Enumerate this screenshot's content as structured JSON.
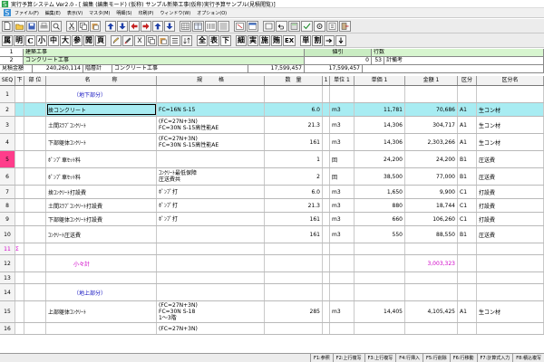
{
  "window": {
    "title": "実行予算システム Ver2.0 - [ 編集 (編集モード) (仮称) サンプル新築工事(仮称)実行予算サンプル(見積閲覧)]"
  },
  "menu": [
    "ファイル(F)",
    "編集(E)",
    "表示(V)",
    "マスタ(M)",
    "明細(S)",
    "印刷(P)",
    "ウィンドウ(W)",
    "オプション(O)"
  ],
  "toolbar2": {
    "kanji_buttons": [
      "属",
      "明",
      "C",
      "小",
      "中",
      "大",
      "参",
      "閲",
      "頁"
    ],
    "group1": [
      "全",
      "表",
      "下"
    ],
    "group2": [
      "細",
      "実",
      "施",
      "賄"
    ],
    "ex": "EX",
    "group3": [
      "単",
      "割"
    ]
  },
  "info": {
    "row1_no": "1",
    "row1_text": "建築工事",
    "row2_no": "2",
    "row2_text": "コンクリート工事",
    "discount_label": "値引",
    "discount_value": "0",
    "lines_label": "行数",
    "lines_value": "53",
    "remark_label": "計備考",
    "est_label": "見積金額",
    "est_value": "240,260,114",
    "layer_label": "階層計",
    "layer_name": "コンクリート工事",
    "sum1": "17,599,457",
    "sum2": "17,599,457"
  },
  "columns": [
    "SEQ",
    "下",
    "部 位",
    "名　　　　称",
    "規　　　格",
    "数　量",
    "1",
    "単位 1",
    "単価 1",
    "金額 1",
    "区分",
    "区分名"
  ],
  "rows": [
    {
      "seq": "1",
      "name": "（地下部分）",
      "spec": [],
      "qty": "",
      "ch": "",
      "unit": "",
      "price": "",
      "amount": "",
      "kb": "",
      "kbn": "",
      "style": "blue"
    },
    {
      "seq": "2",
      "name": "捨コンクリート",
      "spec": [
        "FC=16N S-15"
      ],
      "qty": "6.0",
      "ch": "",
      "unit": "m3",
      "price": "11,781",
      "amount": "70,686",
      "kb": "A1",
      "kbn": "生コン材",
      "style": "selected"
    },
    {
      "seq": "3",
      "name": "土間ｽﾗﾌﾞｺﾝｸﾘｰﾄ",
      "spec": [
        "(FC=27N+3N)",
        "FC=30N S-15高性能AE"
      ],
      "qty": "21.3",
      "ch": "",
      "unit": "m3",
      "price": "14,306",
      "amount": "304,717",
      "kb": "A1",
      "kbn": "生コン材",
      "style": ""
    },
    {
      "seq": "4",
      "name": "下部躯体ｺﾝｸﾘｰﾄ",
      "spec": [
        "(FC=27N+3N)",
        "FC=30N S-15高性能AE"
      ],
      "qty": "161",
      "ch": "",
      "unit": "m3",
      "price": "14,306",
      "amount": "2,303,266",
      "kb": "A1",
      "kbn": "生コン材",
      "style": ""
    },
    {
      "seq": "5",
      "name": "ﾎﾟﾝﾌﾟ車ｾｯﾄ料",
      "spec": [],
      "qty": "1",
      "ch": "",
      "unit": "回",
      "price": "24,200",
      "amount": "24,200",
      "kb": "B1",
      "kbn": "圧送費",
      "style": "pink"
    },
    {
      "seq": "6",
      "name": "ﾎﾟﾝﾌﾟ車ｾｯﾄ料",
      "spec": [
        "ｺﾝｸﾘｰﾄ最低保障",
        "圧送費共"
      ],
      "qty": "2",
      "ch": "",
      "unit": "回",
      "price": "38,500",
      "amount": "77,000",
      "kb": "B1",
      "kbn": "圧送費",
      "style": ""
    },
    {
      "seq": "7",
      "name": "捨ｺﾝｸﾘｰﾄ打設費",
      "spec": [
        "ﾎﾟﾝﾌﾟ打"
      ],
      "qty": "6.0",
      "ch": "",
      "unit": "m3",
      "price": "1,650",
      "amount": "9,900",
      "kb": "C1",
      "kbn": "打設費",
      "style": ""
    },
    {
      "seq": "8",
      "name": "土間ｽﾗﾌﾞｺﾝｸﾘｰﾄ打設費",
      "spec": [
        "ﾎﾟﾝﾌﾟ打"
      ],
      "qty": "21.3",
      "ch": "",
      "unit": "m3",
      "price": "880",
      "amount": "18,744",
      "kb": "C1",
      "kbn": "打設費",
      "style": ""
    },
    {
      "seq": "9",
      "name": "下部躯体ｺﾝｸﾘｰﾄ打設費",
      "spec": [
        "ﾎﾟﾝﾌﾟ打"
      ],
      "qty": "161",
      "ch": "",
      "unit": "m3",
      "price": "660",
      "amount": "106,260",
      "kb": "C1",
      "kbn": "打設費",
      "style": ""
    },
    {
      "seq": "10",
      "name": "ｺﾝｸﾘｰﾄ圧送費",
      "spec": [],
      "qty": "161",
      "ch": "",
      "unit": "m3",
      "price": "550",
      "amount": "88,550",
      "kb": "B1",
      "kbn": "圧送費",
      "style": ""
    },
    {
      "seq": "11",
      "shita": "Σ",
      "name": "",
      "spec": [],
      "qty": "",
      "ch": "",
      "unit": "",
      "price": "",
      "amount": "",
      "kb": "",
      "kbn": "",
      "style": "short"
    },
    {
      "seq": "12",
      "name": "小々計",
      "spec": [],
      "qty": "",
      "ch": "",
      "unit": "",
      "price": "",
      "amount": "3,003,323",
      "kb": "",
      "kbn": "",
      "style": "mag"
    },
    {
      "seq": "13",
      "name": "",
      "spec": [],
      "qty": "",
      "ch": "",
      "unit": "",
      "price": "",
      "amount": "",
      "kb": "",
      "kbn": "",
      "style": "short"
    },
    {
      "seq": "14",
      "name": "（地上部分）",
      "spec": [],
      "qty": "",
      "ch": "",
      "unit": "",
      "price": "",
      "amount": "",
      "kb": "",
      "kbn": "",
      "style": "blue"
    },
    {
      "seq": "15",
      "name": "上部躯体ｺﾝｸﾘｰﾄ",
      "spec": [
        "(FC=27N+3N)",
        "FC=30N S-18",
        "1～3階"
      ],
      "qty": "285",
      "ch": "",
      "unit": "m3",
      "price": "14,405",
      "amount": "4,105,425",
      "kb": "A1",
      "kbn": "生コン材",
      "style": "tall"
    },
    {
      "seq": "16",
      "name": "",
      "spec": [
        "(FC=27N+3N)"
      ],
      "qty": "",
      "ch": "",
      "unit": "",
      "price": "",
      "amount": "",
      "kb": "",
      "kbn": "",
      "style": "short"
    }
  ],
  "status_keys": [
    "F1:参照",
    "F2:上行複写",
    "F3:上行複写",
    "F4:行挿入",
    "F5:行削除",
    "F6:行移動",
    "F7:計算式入力",
    "F8:積込複写"
  ]
}
